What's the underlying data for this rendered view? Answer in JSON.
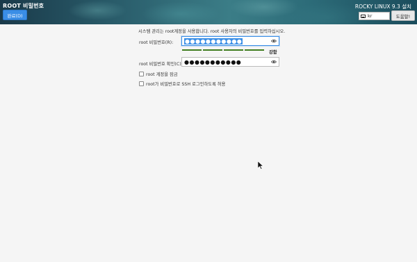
{
  "header": {
    "title": "ROOT 비밀번호",
    "done_label": "완료(D)",
    "product": "ROCKY LINUX 9.3 설치",
    "keyboard_layout": "kr",
    "help_label": "도움말!"
  },
  "main": {
    "instruction": "시스템 관리는 root계정을 사용합니다. root 사용자의 비밀번호를 입력하십시오.",
    "password_label": "root 비밀번호(R):",
    "password_value": "●●●●●●●●●●●",
    "strength_label": "강함",
    "confirm_label": "root 비밀번호 확인(C):",
    "confirm_value": "●●●●●●●●●●●",
    "lock_root_label": "root 계정을 잠금",
    "allow_ssh_label": "root가 비밀번호로 SSH 로그인하도록 허용"
  },
  "colors": {
    "accent": "#3a8ee6",
    "strength_bar": "#3f7d1f"
  },
  "icons": [
    "keyboard-icon",
    "eye-icon",
    "mouse-cursor-icon"
  ]
}
